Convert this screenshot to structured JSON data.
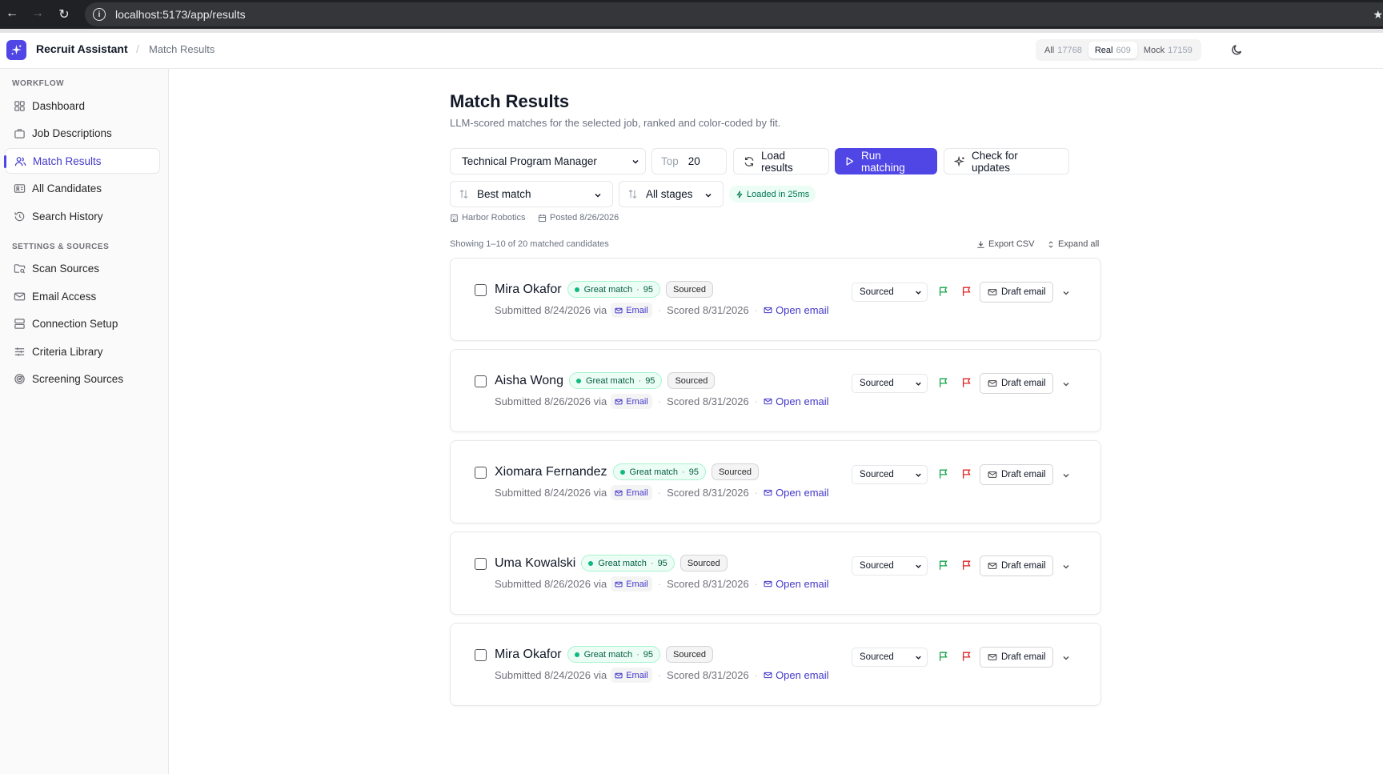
{
  "browser": {
    "url": "localhost:5173/app/results"
  },
  "header": {
    "app_name": "Recruit Assistant",
    "breadcrumb_sep": "/",
    "breadcrumb": "Match Results",
    "segments": [
      {
        "label": "All",
        "count": "17768"
      },
      {
        "label": "Real",
        "count": "609"
      },
      {
        "label": "Mock",
        "count": "17159"
      }
    ]
  },
  "sidebar": {
    "workflow_title": "WORKFLOW",
    "workflow_items": [
      {
        "label": "Dashboard",
        "icon": "grid-icon"
      },
      {
        "label": "Job Descriptions",
        "icon": "briefcase-icon"
      },
      {
        "label": "Match Results",
        "icon": "users-icon"
      },
      {
        "label": "All Candidates",
        "icon": "id-card-icon"
      },
      {
        "label": "Search History",
        "icon": "history-icon"
      }
    ],
    "settings_title": "SETTINGS & SOURCES",
    "settings_items": [
      {
        "label": "Scan Sources",
        "icon": "folder-search-icon"
      },
      {
        "label": "Email Access",
        "icon": "mail-icon"
      },
      {
        "label": "Connection Setup",
        "icon": "server-icon"
      },
      {
        "label": "Criteria Library",
        "icon": "sliders-icon"
      },
      {
        "label": "Screening Sources",
        "icon": "radar-icon"
      }
    ]
  },
  "main": {
    "title": "Match Results",
    "subtitle": "LLM-scored matches for the selected job, ranked and color-coded by fit.",
    "job_select": "Technical Program Manager",
    "top_label": "Top",
    "top_value": "20",
    "load_label": "Load results",
    "run_label": "Run matching",
    "check_label": "Check for updates",
    "sort_select": "Best match",
    "stage_filter": "All stages",
    "loaded_badge": "Loaded in 25ms",
    "company": "Harbor Robotics",
    "posted": "Posted 8/26/2026",
    "showing": "Showing 1–10 of 20 matched candidates",
    "export_label": "Export CSV",
    "expand_label": "Expand all"
  },
  "candidates": [
    {
      "name": "Mira Okafor",
      "match_label": "Great match",
      "score": "95",
      "stage_badge": "Sourced",
      "submitted": "Submitted 8/24/2026 via",
      "source": "Email",
      "scored": "Scored 8/31/2026",
      "open_email": "Open email",
      "stage_select": "Sourced",
      "draft": "Draft email"
    },
    {
      "name": "Aisha Wong",
      "match_label": "Great match",
      "score": "95",
      "stage_badge": "Sourced",
      "submitted": "Submitted 8/26/2026 via",
      "source": "Email",
      "scored": "Scored 8/31/2026",
      "open_email": "Open email",
      "stage_select": "Sourced",
      "draft": "Draft email"
    },
    {
      "name": "Xiomara Fernandez",
      "match_label": "Great match",
      "score": "95",
      "stage_badge": "Sourced",
      "submitted": "Submitted 8/24/2026 via",
      "source": "Email",
      "scored": "Scored 8/31/2026",
      "open_email": "Open email",
      "stage_select": "Sourced",
      "draft": "Draft email"
    },
    {
      "name": "Uma Kowalski",
      "match_label": "Great match",
      "score": "95",
      "stage_badge": "Sourced",
      "submitted": "Submitted 8/26/2026 via",
      "source": "Email",
      "scored": "Scored 8/31/2026",
      "open_email": "Open email",
      "stage_select": "Sourced",
      "draft": "Draft email"
    },
    {
      "name": "Mira Okafor",
      "match_label": "Great match",
      "score": "95",
      "stage_badge": "Sourced",
      "submitted": "Submitted 8/24/2026 via",
      "source": "Email",
      "scored": "Scored 8/31/2026",
      "open_email": "Open email",
      "stage_select": "Sourced",
      "draft": "Draft email"
    }
  ],
  "colors": {
    "accent": "#4f46e5",
    "match_green": "#10b981",
    "flag_green": "#16a34a",
    "flag_red": "#dc2626"
  }
}
